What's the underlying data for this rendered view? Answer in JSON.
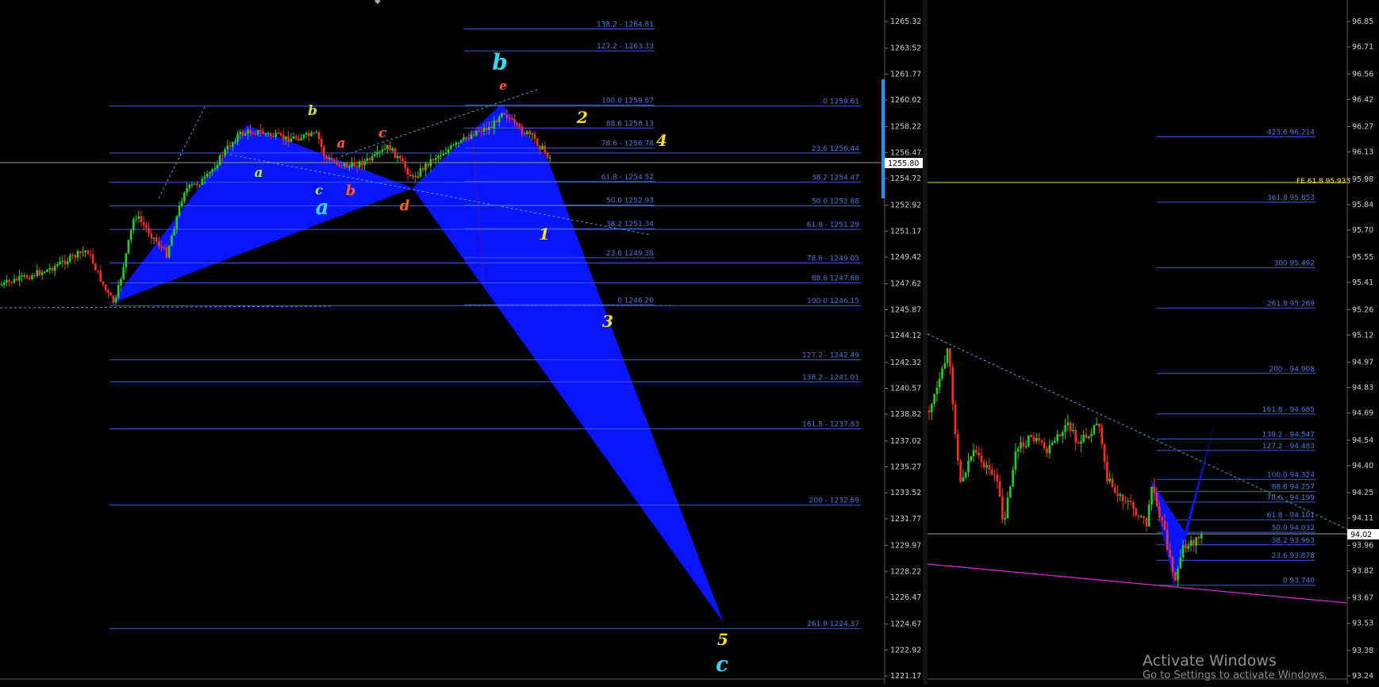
{
  "left_chart": {
    "price_min": 1221.17,
    "price_max": 1265.32,
    "price_axis_ticks": [
      "1265.32",
      "1263.52",
      "1261.77",
      "1260.02",
      "1258.22",
      "1256.47",
      "1254.72",
      "1252.92",
      "1251.17",
      "1249.42",
      "1247.62",
      "1245.87",
      "1244.12",
      "1242.32",
      "1240.57",
      "1238.82",
      "1237.02",
      "1235.27",
      "1233.52",
      "1231.77",
      "1229.97",
      "1228.22",
      "1226.47",
      "1224.67",
      "1222.92",
      "1221.17"
    ],
    "current_price_label": "1255.80",
    "current_price": 1255.8,
    "fib_levels_upper": [
      {
        "label": "138.2 - 1264.81",
        "price": 1264.81
      },
      {
        "label": "127.2 - 1263.33",
        "price": 1263.33
      },
      {
        "label": "100.0 1259.67",
        "price": 1259.67
      },
      {
        "label": "88.6 1258.13",
        "price": 1258.13
      },
      {
        "label": "78.6 - 1256.78",
        "price": 1256.78
      },
      {
        "label": "61.8 - 1254.52",
        "price": 1254.52
      },
      {
        "label": "50.0 1252.93",
        "price": 1252.93
      },
      {
        "label": "38.2 1251.34",
        "price": 1251.34
      },
      {
        "label": "23.6 1249.38",
        "price": 1249.38
      },
      {
        "label": "0 1246.20",
        "price": 1246.2
      }
    ],
    "fib_levels_right": [
      {
        "label": "0 1259.61",
        "price": 1259.61
      },
      {
        "label": "23.6 1256.44",
        "price": 1256.44
      },
      {
        "label": "38.2 1254.47",
        "price": 1254.47
      },
      {
        "label": "50.0 1252.88",
        "price": 1252.88
      },
      {
        "label": "61.8 - 1251.29",
        "price": 1251.29
      },
      {
        "label": "78.6 - 1249.03",
        "price": 1249.03
      },
      {
        "label": "88.6 1247.68",
        "price": 1247.68
      },
      {
        "label": "100.0 1246.15",
        "price": 1246.15
      },
      {
        "label": "127.2 - 1242.49",
        "price": 1242.49
      },
      {
        "label": "138.2 - 1241.01",
        "price": 1241.01
      },
      {
        "label": "161.8 - 1237.83",
        "price": 1237.83
      },
      {
        "label": "200 - 1232.69",
        "price": 1232.69
      },
      {
        "label": "261.8 1224.37",
        "price": 1224.37
      }
    ],
    "wave_labels": [
      {
        "text": "b",
        "color": "#37d8ff"
      },
      {
        "text": "e",
        "color": "#ff5a2c"
      },
      {
        "text": "b",
        "color": "#c8e04a"
      },
      {
        "text": "a",
        "color": "#ff5a2c"
      },
      {
        "text": "c",
        "color": "#ff5a2c"
      },
      {
        "text": "a",
        "color": "#c8e04a"
      },
      {
        "text": "c",
        "color": "#c8e04a"
      },
      {
        "text": "b",
        "color": "#ff5a2c"
      },
      {
        "text": "a",
        "color": "#37d8ff"
      },
      {
        "text": "d",
        "color": "#ff5a2c"
      },
      {
        "text": "2",
        "color": "#f7e01a"
      },
      {
        "text": "4",
        "color": "#f7e01a"
      },
      {
        "text": "1",
        "color": "#f7e01a"
      },
      {
        "text": "3",
        "color": "#f7e01a"
      },
      {
        "text": "5",
        "color": "#f7e01a"
      },
      {
        "text": "c",
        "color": "#37d8ff"
      }
    ]
  },
  "right_chart": {
    "price_min": 93.24,
    "price_max": 96.85,
    "price_axis_ticks": [
      "96.85",
      "96.71",
      "96.56",
      "96.42",
      "96.27",
      "96.13",
      "95.98",
      "95.84",
      "95.70",
      "95.55",
      "95.41",
      "95.26",
      "95.12",
      "94.97",
      "94.83",
      "94.69",
      "94.54",
      "94.40",
      "94.25",
      "94.11",
      "93.96",
      "93.82",
      "93.67",
      "93.53",
      "93.38",
      "93.24"
    ],
    "current_price_label": "94.02",
    "current_price": 94.02,
    "fe_label": "FE 61.8 95.935",
    "fe_price": 95.935,
    "fib_levels": [
      {
        "label": "423.6 96.214",
        "price": 96.214
      },
      {
        "label": "361.8 95.853",
        "price": 95.853
      },
      {
        "label": "300 95.492",
        "price": 95.492
      },
      {
        "label": "261.8 95.269",
        "price": 95.269
      },
      {
        "label": "200 - 94.908",
        "price": 94.908
      },
      {
        "label": "161.8 - 94.685",
        "price": 94.685
      },
      {
        "label": "138.2 - 94.547",
        "price": 94.547
      },
      {
        "label": "127.2 - 94.483",
        "price": 94.483
      },
      {
        "label": "100.0 94.324",
        "price": 94.324
      },
      {
        "label": "88.6 94.257",
        "price": 94.257
      },
      {
        "label": "78.6 - 94.199",
        "price": 94.199
      },
      {
        "label": "61.8 - 94.101",
        "price": 94.101
      },
      {
        "label": "50.0 94.032",
        "price": 94.032
      },
      {
        "label": "38.2 93.963",
        "price": 93.963
      },
      {
        "label": "23.6 93.878",
        "price": 93.878
      },
      {
        "label": "0 93.740",
        "price": 93.74
      }
    ]
  },
  "colors": {
    "background": "#000000",
    "fib_line": "#3d5bd8",
    "fib_text": "#4a78e0",
    "harmonic_fill": "#0a14ff",
    "trend_dashed": "#4fa3d8",
    "support_line": "#d02ad0",
    "fe_line": "#e0e040",
    "bull_candle": "#1fd21f",
    "bear_candle": "#ff2b1b",
    "axis_text": "#cfcfcf",
    "current_price_line": "#9a9a9a"
  },
  "watermark": {
    "title": "Activate Windows",
    "subtitle": "Go to Settings to activate Windows."
  }
}
